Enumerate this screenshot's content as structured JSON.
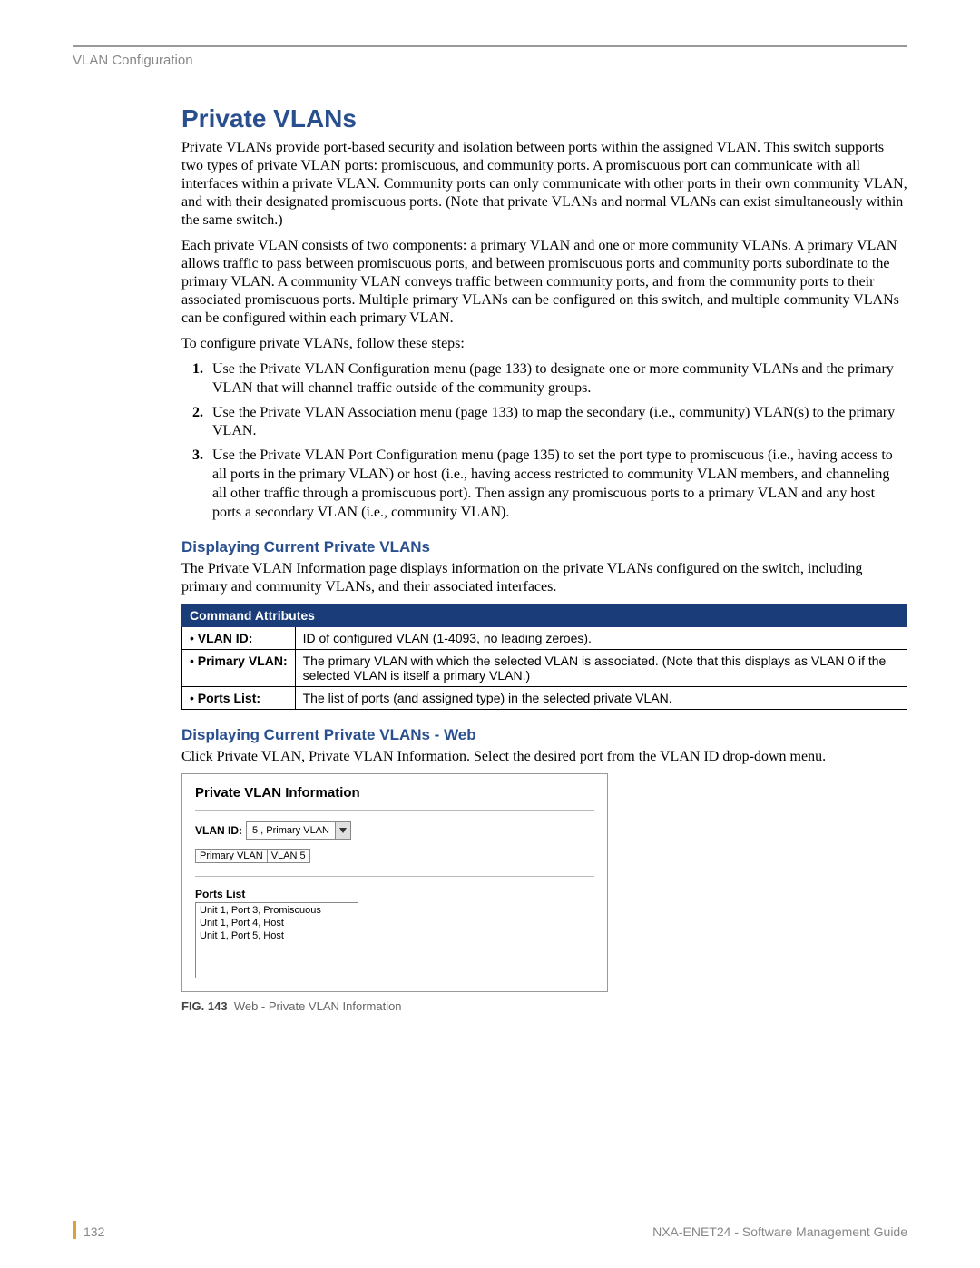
{
  "header": {
    "section": "VLAN Configuration"
  },
  "title": "Private VLANs",
  "intro1": "Private VLANs provide port-based security and isolation between ports within the assigned VLAN. This switch supports two types of private VLAN ports: promiscuous, and community ports. A promiscuous port can communicate with all interfaces within a private VLAN. Community ports can only communicate with other ports in their own community VLAN, and with their designated promiscuous ports. (Note that private VLANs and normal VLANs can exist simultaneously within the same switch.)",
  "intro2": "Each private VLAN consists of two components: a primary VLAN and one or more community VLANs. A primary VLAN allows traffic to pass between promiscuous ports, and between promiscuous ports and community ports subordinate to the primary VLAN. A community VLAN conveys traffic between community ports, and from the community ports to their associated promiscuous ports. Multiple primary VLANs can be configured on this switch, and multiple community VLANs can be configured within each primary VLAN.",
  "intro3": "To configure private VLANs, follow these steps:",
  "steps": [
    "Use the Private VLAN Configuration menu (page 133) to designate one or more community VLANs and the primary VLAN that will channel traffic outside of the community groups.",
    "Use the Private VLAN Association menu (page 133) to map the secondary (i.e., community) VLAN(s) to the primary VLAN.",
    "Use the Private VLAN Port Configuration menu (page 135) to set the port type to promiscuous (i.e., having access to all ports in the primary VLAN) or host (i.e., having access restricted to community VLAN members, and channeling all other traffic through a promiscuous port). Then assign any promiscuous ports to a primary VLAN and any host ports a secondary VLAN (i.e., community VLAN)."
  ],
  "sec1_title": "Displaying Current Private VLANs",
  "sec1_body": "The Private VLAN Information page displays information on the private VLANs configured on the switch, including primary and community VLANs, and their associated interfaces.",
  "cmd_table": {
    "header": "Command Attributes",
    "rows": [
      {
        "attr": "VLAN ID:",
        "desc": "ID of configured VLAN (1-4093, no leading zeroes)."
      },
      {
        "attr": "Primary VLAN:",
        "desc": "The primary VLAN with which the selected VLAN is associated. (Note that this displays as VLAN 0 if the selected VLAN is itself a primary VLAN.)"
      },
      {
        "attr": "Ports List:",
        "desc": "The list of ports (and assigned type) in the selected private VLAN."
      }
    ]
  },
  "sec2_title": "Displaying Current Private VLANs - Web",
  "sec2_body": "Click Private VLAN, Private VLAN Information. Select the desired port from the VLAN ID drop-down menu.",
  "figure": {
    "panel_title": "Private VLAN Information",
    "vlanid_label": "VLAN ID:",
    "vlanid_value": "5 , Primary VLAN",
    "pvlan_col1": "Primary VLAN",
    "pvlan_col2": "VLAN 5",
    "portslist_label": "Ports List",
    "ports": [
      "Unit 1, Port 3, Promiscuous",
      "Unit 1, Port 4, Host",
      "Unit 1, Port 5, Host"
    ],
    "caption_num": "FIG. 143",
    "caption_text": "Web - Private VLAN Information"
  },
  "footer": {
    "page": "132",
    "doc": "NXA-ENET24 - Software Management Guide"
  }
}
